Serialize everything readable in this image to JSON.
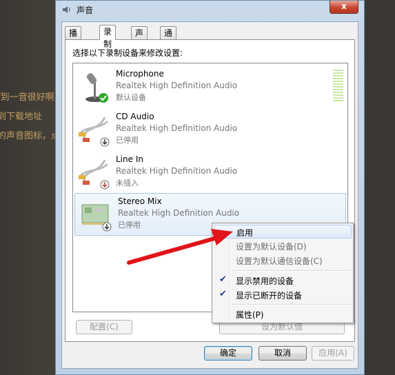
{
  "window": {
    "title": "声音",
    "close_label": "x"
  },
  "background_text": [
    "f到一音很好啊",
    "到下载地址",
    "的声音图标，点"
  ],
  "tabs": [
    {
      "label": "播放",
      "active": false
    },
    {
      "label": "录制",
      "active": true
    },
    {
      "label": "声音",
      "active": false
    },
    {
      "label": "通信",
      "active": false
    }
  ],
  "instruction": "选择以下录制设备来修改设置:",
  "devices": [
    {
      "name": "Microphone",
      "description": "Realtek High Definition Audio",
      "status": "默认设备",
      "icon": "microphone-icon",
      "badge": "green-check-icon"
    },
    {
      "name": "CD Audio",
      "description": "Realtek High Definition Audio",
      "status": "已停用",
      "icon": "audio-cable-icon",
      "badge": "down-arrow-icon"
    },
    {
      "name": "Line In",
      "description": "Realtek High Definition Audio",
      "status": "未插入",
      "icon": "audio-cable-icon",
      "badge": "down-arrow-icon"
    },
    {
      "name": "Stereo Mix",
      "description": "Realtek High Definition Audio",
      "status": "已停用",
      "icon": "sound-card-icon",
      "badge": "down-arrow-icon"
    }
  ],
  "buttons": {
    "configure": "配置(C)",
    "set_default": "设为默认值",
    "properties": "属性(P)",
    "ok": "确定",
    "cancel": "取消",
    "apply": "应用(A)"
  },
  "context_menu": {
    "items": [
      {
        "label": "启用",
        "checked": false,
        "disabled": false
      },
      {
        "label": "设置为默认设备(D)",
        "checked": false,
        "disabled": true
      },
      {
        "label": "设置为默认通信设备(C)",
        "checked": false,
        "disabled": true
      },
      {
        "label": "显示禁用的设备",
        "checked": true,
        "disabled": false
      },
      {
        "label": "显示已断开的设备",
        "checked": true,
        "disabled": false
      },
      {
        "label": "属性(P)",
        "checked": false,
        "disabled": false
      }
    ]
  },
  "colors": {
    "accent": "#3c7fb1",
    "arrow": "#e0141a",
    "check_green": "#2ea52c"
  }
}
